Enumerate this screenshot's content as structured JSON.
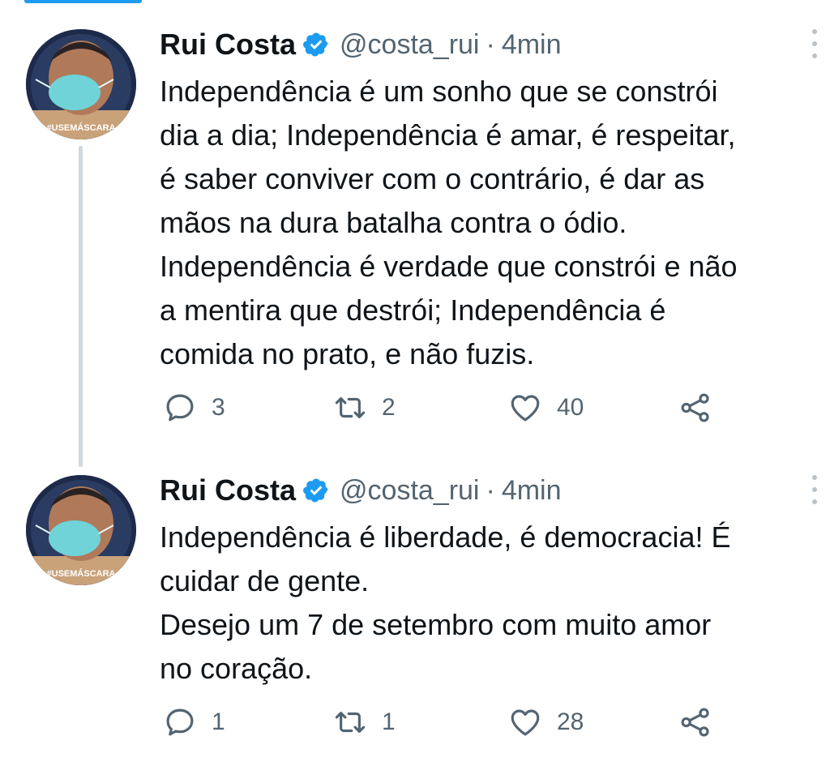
{
  "thread": [
    {
      "author": {
        "name": "Rui Costa",
        "handle": "@costa_rui",
        "separator": "·",
        "time": "4min",
        "avatar_badge": "#USEMÁSCARA"
      },
      "text": "Independência é um sonho que se constrói\ndia a dia; Independência é amar, é respeitar,\né saber conviver com o contrário, é dar as\nmãos na dura batalha contra o ódio.\nIndependência é verdade que constrói e não\na mentira que destrói; Independência é\ncomida no prato, e não fuzis.",
      "stats": {
        "replies": "3",
        "retweets": "2",
        "likes": "40"
      }
    },
    {
      "author": {
        "name": "Rui Costa",
        "handle": "@costa_rui",
        "separator": "·",
        "time": "4min",
        "avatar_badge": "#USEMÁSCARA"
      },
      "text": "Independência é liberdade, é democracia! É\ncuidar de gente.\nDesejo um 7 de setembro com muito amor\nno coração.",
      "stats": {
        "replies": "1",
        "retweets": "1",
        "likes": "28"
      }
    }
  ],
  "icons": {
    "verified": "verified-badge-icon",
    "reply": "reply-icon",
    "retweet": "retweet-icon",
    "like": "heart-icon",
    "share": "share-icon",
    "more": "more-vertical-icon"
  },
  "colors": {
    "verified_blue": "#1d9bf0",
    "text": "#0f1419",
    "secondary": "#536471",
    "thread_line": "#cfd9de",
    "avatar_bg": "#1d2a4a",
    "mask": "#6fd3d8"
  }
}
